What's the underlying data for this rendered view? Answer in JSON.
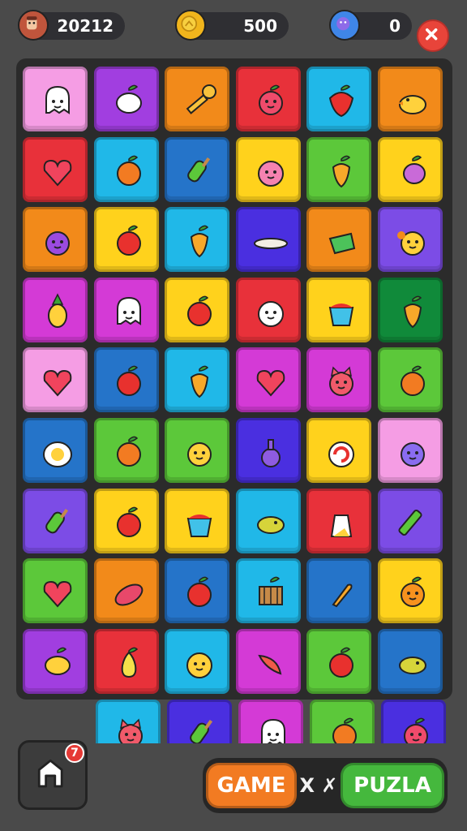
{
  "hud": {
    "score": "20212",
    "coins": "500",
    "gems": "0",
    "avatar_icon": "avatar-icon",
    "coin_icon": "coin-icon",
    "gem_icon": "gem-icon",
    "close_icon": "close-icon"
  },
  "notification_badge": "7",
  "footer": {
    "game_label": "GAME",
    "vs_label": "X ✗",
    "puzzle_label": "PUZLA"
  },
  "colors": {
    "pink": "#f59de4",
    "purple": "#a13ee0",
    "orange": "#f28a1a",
    "red": "#e8313a",
    "cyan": "#20b8e8",
    "blue": "#2574c9",
    "yellow": "#ffd21c",
    "green": "#5cc83a",
    "magenta": "#d43ad6",
    "indigo": "#4a2fe0",
    "darkgreen": "#108a3a",
    "violet": "#7c4ce6"
  },
  "tiles": [
    [
      "pink:ghost",
      "purple:turnip",
      "orange:key",
      "red:apple-face",
      "cyan:strawberry",
      "orange:duck"
    ],
    [
      "red:heart",
      "cyan:orange",
      "blue:popsicle",
      "yellow:peach-face",
      "green:mango",
      "yellow:plum"
    ],
    [
      "orange:plum-face",
      "yellow:apple",
      "cyan:mango",
      "indigo:spoon",
      "orange:cabbage",
      "violet:flower-face"
    ],
    [
      "magenta:pineapple",
      "magenta:ghost",
      "yellow:apple",
      "red:ghost-face",
      "yellow:basket",
      "darkgreen:mango"
    ],
    [
      "pink:heart",
      "blue:apple",
      "cyan:mango",
      "magenta:heart",
      "magenta:cat-face",
      "green:orange"
    ],
    [
      "blue:egg",
      "green:orange",
      "green:chick-face",
      "indigo:potion",
      "yellow:candy",
      "pink:berry-face"
    ],
    [
      "violet:popsicle",
      "yellow:apple",
      "yellow:basket",
      "cyan:bird",
      "red:cat",
      "violet:pen"
    ],
    [
      "green:heart",
      "orange:sweet-potato",
      "blue:apple",
      "cyan:crate",
      "blue:carrot",
      "yellow:orange-face"
    ],
    [
      "purple:lemon",
      "red:pear",
      "cyan:smiley",
      "magenta:fish",
      "green:apple",
      "blue:bird"
    ]
  ],
  "strip_tiles": [
    "cyan:cat-face",
    "indigo:popsicle",
    "magenta:ghost",
    "green:orange",
    "indigo:apple-face"
  ]
}
